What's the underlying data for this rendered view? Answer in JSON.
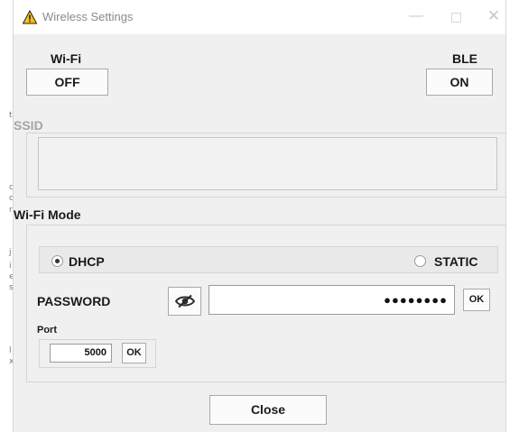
{
  "window": {
    "title": "Wireless Settings"
  },
  "wifi": {
    "label": "Wi-Fi",
    "toggle_value": "OFF"
  },
  "ble": {
    "label": "BLE",
    "toggle_value": "ON"
  },
  "ssid": {
    "label": "SSID",
    "value": ""
  },
  "wifi_mode": {
    "label": "Wi-Fi Mode",
    "options": [
      {
        "label": "DHCP",
        "selected": true
      },
      {
        "label": "STATIC",
        "selected": false
      }
    ]
  },
  "password": {
    "label": "PASSWORD",
    "value_masked": "●●●●●●●●",
    "ok_label": "OK",
    "visibility_icon": "eye-off-icon"
  },
  "port": {
    "label": "Port",
    "value": "5000",
    "ok_label": "OK"
  },
  "footer": {
    "close_label": "Close"
  }
}
